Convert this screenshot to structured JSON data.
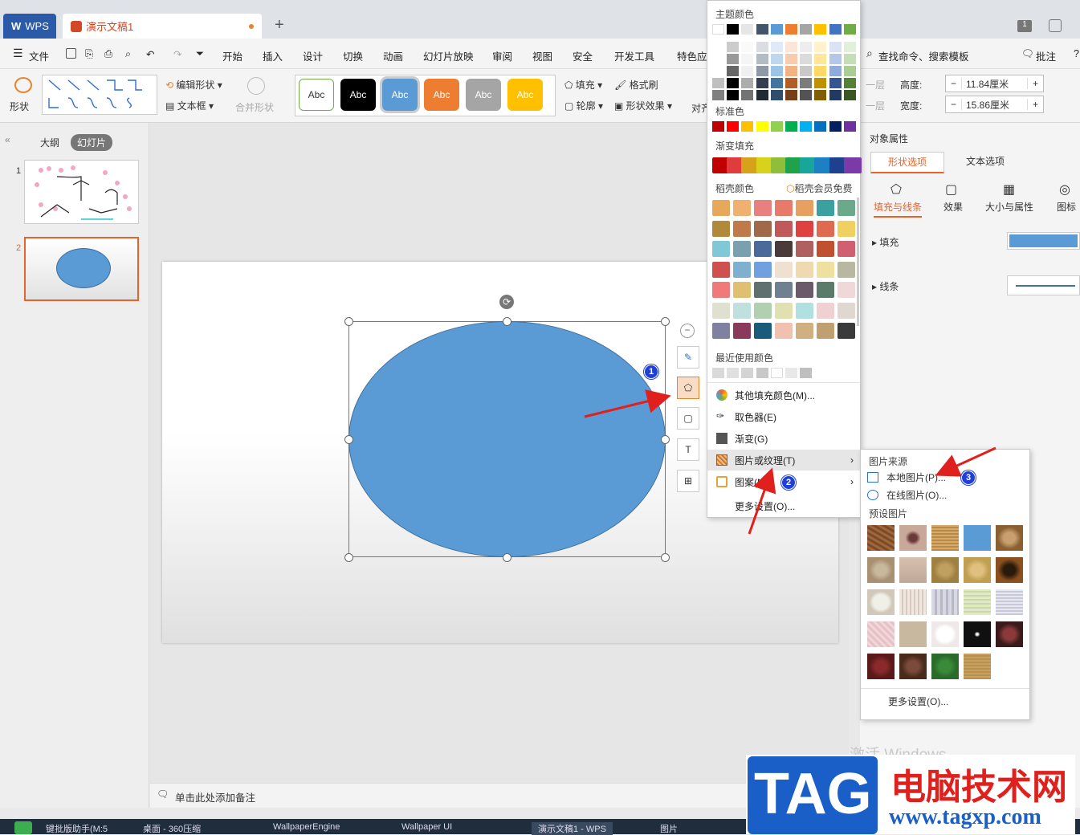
{
  "titlebar": {
    "wps_tab": "WPS",
    "doc_tab": "演示文稿1",
    "new_tab": "+",
    "badge": "1"
  },
  "menu": {
    "file": "文件",
    "items": [
      "开始",
      "插入",
      "设计",
      "切换",
      "动画",
      "幻灯片放映",
      "审阅",
      "视图",
      "安全",
      "开发工具",
      "特色应"
    ],
    "search": "查找命令、搜索模板",
    "comment": "批注"
  },
  "ribbon": {
    "shape": "形状",
    "edit_shape": "编辑形状",
    "textbox": "文本框",
    "merge_shape": "合并形状",
    "styles": [
      "Abc",
      "Abc",
      "Abc",
      "Abc",
      "Abc",
      "Abc"
    ],
    "fill": "填充",
    "format_brush": "格式刷",
    "outline": "轮廓",
    "shape_effect": "形状效果",
    "align": "对齐",
    "height_label": "高度:",
    "height_value": "11.84厘米",
    "width_label": "宽度:",
    "width_value": "15.86厘米",
    "minus": "−",
    "plus": "+",
    "layer_up": "一层",
    "layer_down": "一层"
  },
  "leftpanel": {
    "outline_tab": "大纲",
    "slides_tab": "幻灯片",
    "slide_numbers": [
      "1",
      "2"
    ]
  },
  "notes": {
    "placeholder": "单击此处添加备注"
  },
  "colors": {
    "accent": "#e8632c",
    "shape_fill": "#5b9bd5",
    "wps_blue": "#2b5aa8"
  },
  "color_popup": {
    "theme_title": "主题颜色",
    "standard_title": "标准色",
    "gradient_title": "渐变填充",
    "docer_title": "稻壳颜色",
    "docer_member": "稻壳会员免费",
    "recent_title": "最近使用颜色",
    "theme_top": [
      "#ffffff",
      "#000000",
      "#e7e6e6",
      "#44546a",
      "#5b9bd5",
      "#ed7d31",
      "#a5a5a5",
      "#ffc000",
      "#4472c4",
      "#70ad47"
    ],
    "standard": [
      "#c00000",
      "#ff0000",
      "#ffc000",
      "#ffff00",
      "#92d050",
      "#00b050",
      "#00b0f0",
      "#0070c0",
      "#002060",
      "#7030a0"
    ],
    "gradient": [
      "#c00000",
      "#e03c3c",
      "#d6a21a",
      "#d8d21a",
      "#8fbf3a",
      "#1fa34a",
      "#16a69a",
      "#1d7fc4",
      "#1f3f8f",
      "#7a3aa8"
    ],
    "recent": [
      "#d9d9d9",
      "#e0e0e0",
      "#d4d4d4",
      "#c8c8c8",
      "#ffffff",
      "#e8e8e8",
      "#bfbfbf"
    ],
    "menu": [
      "其他填充颜色(M)...",
      "取色器(E)",
      "渐变(G)",
      "图片或纹理(T)",
      "图案(N)",
      "更多设置(O)..."
    ]
  },
  "submenu": {
    "source_title": "图片来源",
    "local": "本地图片(P)...",
    "online": "在线图片(O)...",
    "preset_title": "预设图片",
    "more": "更多设置(O)..."
  },
  "rightpanel": {
    "object_props": "对象属性",
    "tab_shape": "形状选项",
    "tab_text": "文本选项",
    "sub_tabs": [
      "填充与线条",
      "效果",
      "大小与属性",
      "图标"
    ],
    "fill": "填充",
    "line": "线条"
  },
  "badges": [
    "1",
    "2",
    "3"
  ],
  "taskbar": [
    "键批版助手(M:5",
    "桌面 - 360压缩",
    "WallpaperEngine",
    "Wallpaper UI",
    "演示文稿1 - WPS",
    "图片"
  ],
  "activate": "激活 Windows",
  "watermark": {
    "tag": "TAG",
    "title": "电脑技术网",
    "url": "www.tagxp.com"
  }
}
